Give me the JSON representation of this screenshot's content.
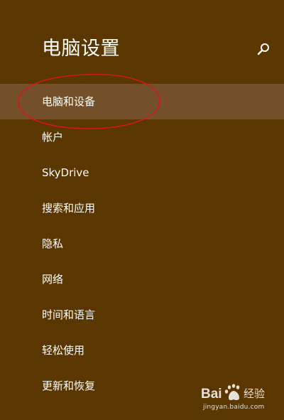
{
  "header": {
    "title": "电脑设置",
    "search_icon": "search-icon"
  },
  "nav": {
    "items": [
      {
        "label": "电脑和设备",
        "selected": true
      },
      {
        "label": "帐户"
      },
      {
        "label": "SkyDrive"
      },
      {
        "label": "搜索和应用"
      },
      {
        "label": "隐私"
      },
      {
        "label": "网络"
      },
      {
        "label": "时间和语言"
      },
      {
        "label": "轻松使用"
      },
      {
        "label": "更新和恢复"
      }
    ]
  },
  "watermark": {
    "text": "Bai 经验",
    "url": "jingyan.baidu.com"
  },
  "colors": {
    "background": "#5a3600",
    "selected_background": "#74502a",
    "annotation": "#d4181e"
  }
}
